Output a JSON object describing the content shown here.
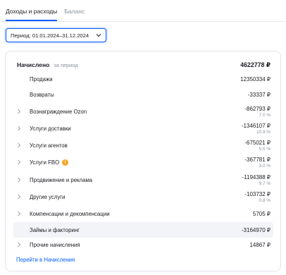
{
  "tabs": [
    {
      "label": "Доходы и расходы",
      "active": true
    },
    {
      "label": "Баланс",
      "active": false
    }
  ],
  "period": {
    "label": "Период: 01.01.2024–31.12.2024"
  },
  "accent": "#005bff",
  "card": {
    "title": "Начислено",
    "subtitle": "за период",
    "total": "4622778 ₽"
  },
  "rows": [
    {
      "label": "Продажи",
      "amount": "12350334 ₽",
      "pct": "",
      "expandable": false,
      "warning": false,
      "highlight": false
    },
    {
      "label": "Возвраты",
      "amount": "-33337 ₽",
      "pct": "",
      "expandable": false,
      "warning": false,
      "highlight": false
    },
    {
      "label": "Вознаграждение Ozon",
      "amount": "-862793 ₽",
      "pct": "7.0 %",
      "expandable": true,
      "warning": false,
      "highlight": false
    },
    {
      "label": "Услуги доставки",
      "amount": "-1346107 ₽",
      "pct": "10.9 %",
      "expandable": true,
      "warning": false,
      "highlight": false
    },
    {
      "label": "Услуги агентов",
      "amount": "-675021 ₽",
      "pct": "5.5 %",
      "expandable": true,
      "warning": false,
      "highlight": false
    },
    {
      "label": "Услуги FBO",
      "amount": "-367781 ₽",
      "pct": "3.0 %",
      "expandable": true,
      "warning": true,
      "highlight": false
    },
    {
      "label": "Продвижение и реклама",
      "amount": "-1194388 ₽",
      "pct": "9.7 %",
      "expandable": true,
      "warning": false,
      "highlight": false
    },
    {
      "label": "Другие услуги",
      "amount": "-103732 ₽",
      "pct": "0.8 %",
      "expandable": true,
      "warning": false,
      "highlight": false
    },
    {
      "label": "Компенсации и декомпенсации",
      "amount": "5705 ₽",
      "pct": "",
      "expandable": true,
      "warning": false,
      "highlight": false
    },
    {
      "label": "Займы и факторинг",
      "amount": "-3164970 ₽",
      "pct": "",
      "expandable": false,
      "warning": false,
      "highlight": true
    },
    {
      "label": "Прочие начисления",
      "amount": "14867 ₽",
      "pct": "",
      "expandable": true,
      "warning": false,
      "highlight": false
    }
  ],
  "link": {
    "label": "Перейти в Начисления"
  }
}
